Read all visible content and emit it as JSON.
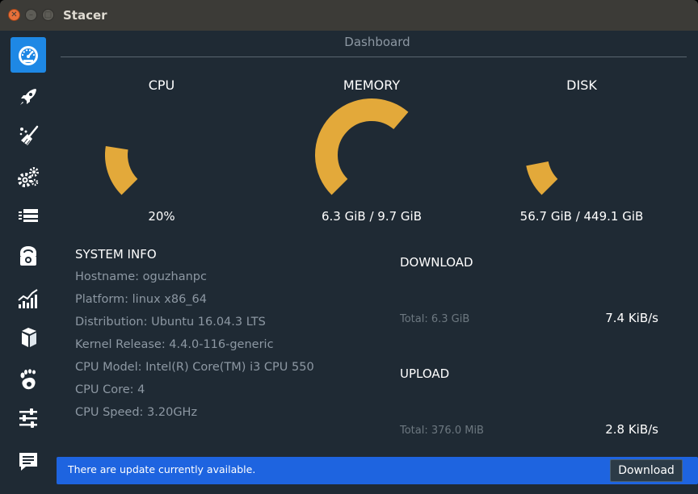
{
  "window": {
    "title": "Stacer"
  },
  "sidebar": {
    "items": [
      {
        "name": "dashboard",
        "icon": "speedometer-icon",
        "active": true
      },
      {
        "name": "startup-apps",
        "icon": "rocket-icon",
        "active": false
      },
      {
        "name": "system-cleaner",
        "icon": "broom-icon",
        "active": false
      },
      {
        "name": "services",
        "icon": "gears-icon",
        "active": false
      },
      {
        "name": "processes",
        "icon": "processes-icon",
        "active": false
      },
      {
        "name": "uninstaller",
        "icon": "package-icon",
        "active": false
      },
      {
        "name": "resources",
        "icon": "chart-icon",
        "active": false
      },
      {
        "name": "apt-repository",
        "icon": "box-icon",
        "active": false
      },
      {
        "name": "gnome-settings",
        "icon": "gnome-foot-icon",
        "active": false
      },
      {
        "name": "settings",
        "icon": "sliders-icon",
        "active": false
      },
      {
        "name": "feedback",
        "icon": "message-icon",
        "active": false
      }
    ]
  },
  "dashboard": {
    "title": "Dashboard",
    "gauges": {
      "cpu": {
        "label": "CPU",
        "value": "20%",
        "fraction": 0.2
      },
      "memory": {
        "label": "MEMORY",
        "value": "6.3 GiB / 9.7 GiB",
        "fraction": 0.65
      },
      "disk": {
        "label": "DISK",
        "value": "56.7 GiB / 449.1 GiB",
        "fraction": 0.126
      }
    },
    "system_info": {
      "title": "SYSTEM INFO",
      "lines": [
        "Hostname: oguzhanpc",
        "Platform: linux x86_64",
        "Distribution: Ubuntu 16.04.3 LTS",
        "Kernel Release: 4.4.0-116-generic",
        "CPU Model: Intel(R) Core(TM) i3 CPU 550",
        "CPU Core: 4",
        "CPU Speed: 3.20GHz"
      ]
    },
    "network": {
      "download": {
        "title": "DOWNLOAD",
        "total": "Total: 6.3 GiB",
        "speed": "7.4 KiB/s"
      },
      "upload": {
        "title": "UPLOAD",
        "total": "Total: 376.0 MiB",
        "speed": "2.8 KiB/s"
      }
    },
    "update_bar": {
      "message": "There are update currently available.",
      "button_label": "Download"
    }
  },
  "colors": {
    "accent": "#1e88e5",
    "gauge_fill": "#e3a93a",
    "background": "#1f2a34",
    "update_bar": "#1e64e0"
  }
}
